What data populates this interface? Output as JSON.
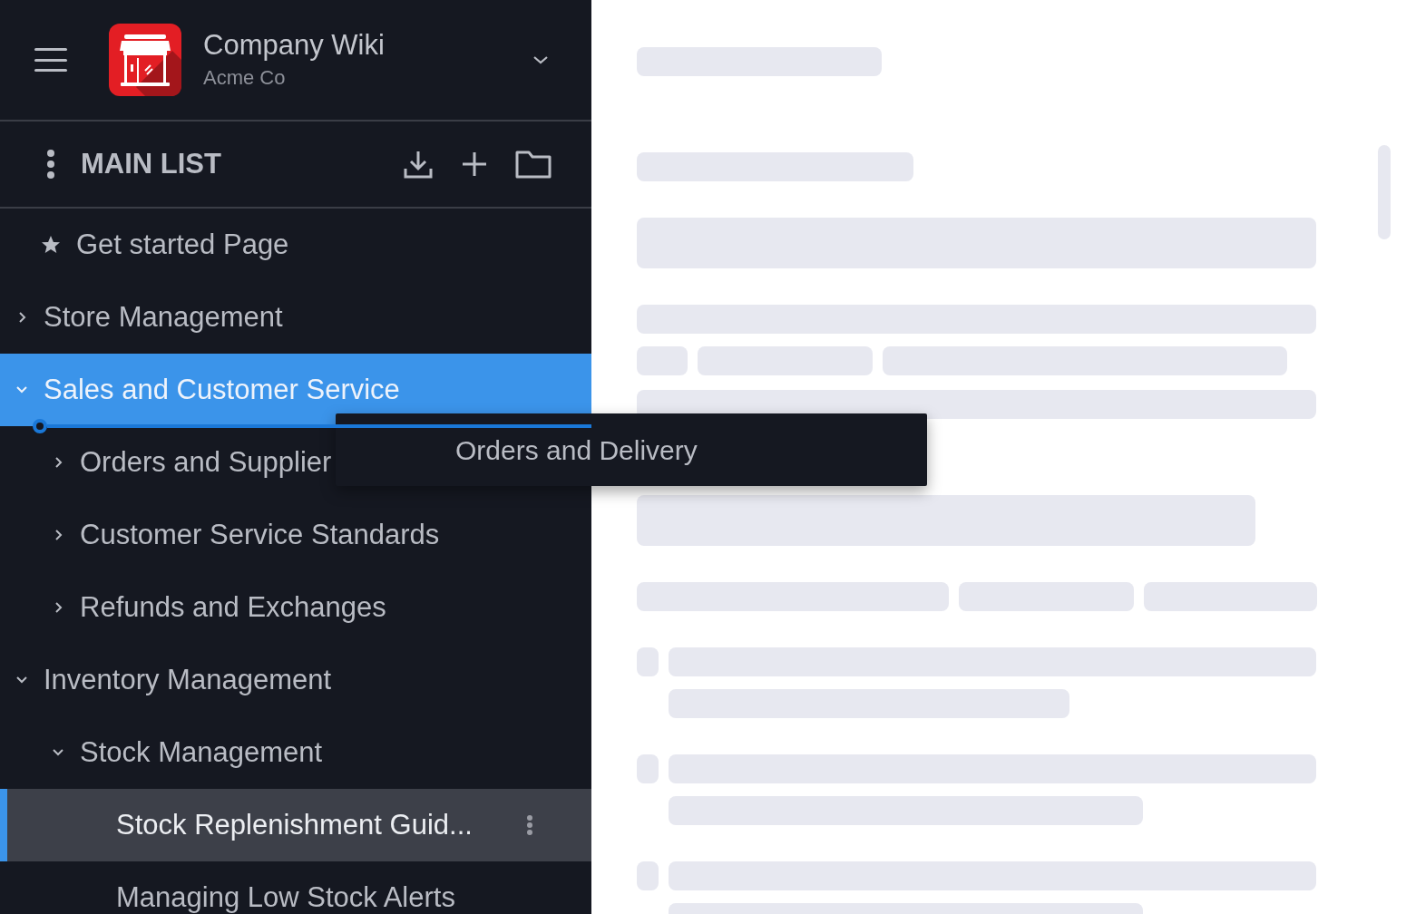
{
  "workspace": {
    "title": "Company Wiki",
    "subtitle": "Acme Co"
  },
  "list_header": {
    "title": "MAIN LIST"
  },
  "tree": [
    {
      "kind": "star",
      "label": "Get started Page",
      "selected": false,
      "drop_target": false
    },
    {
      "kind": "folder",
      "label": "Store Management",
      "expanded": false,
      "selected": false,
      "drop_target": false
    },
    {
      "kind": "folder",
      "label": "Sales and Customer Service",
      "expanded": true,
      "selected": false,
      "drop_target": true,
      "children": [
        {
          "kind": "folder",
          "label": "Orders and Supplier",
          "expanded": false,
          "selected": false,
          "drop_target": false
        },
        {
          "kind": "folder",
          "label": "Customer Service Standards",
          "expanded": false,
          "selected": false,
          "drop_target": false
        },
        {
          "kind": "folder",
          "label": "Refunds and Exchanges",
          "expanded": false,
          "selected": false,
          "drop_target": false
        }
      ]
    },
    {
      "kind": "folder",
      "label": "Inventory Management",
      "expanded": true,
      "selected": false,
      "drop_target": false,
      "children": [
        {
          "kind": "folder",
          "label": "Stock Management",
          "expanded": true,
          "selected": false,
          "drop_target": false,
          "children": [
            {
              "kind": "page",
              "label": "Stock Replenishment Guid...",
              "selected": true,
              "drop_target": false
            },
            {
              "kind": "page",
              "label": "Managing Low Stock Alerts",
              "selected": false,
              "drop_target": false
            }
          ]
        }
      ]
    }
  ],
  "drag_preview": {
    "label": "Orders and Delivery"
  },
  "content": {
    "loading": true
  }
}
